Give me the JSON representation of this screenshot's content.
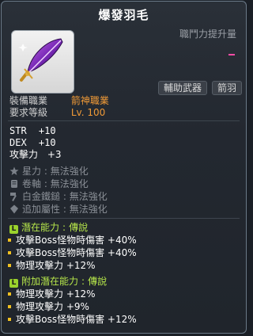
{
  "title": "爆發羽毛",
  "power_label": "職鬥力提升量",
  "tags": [
    "輔助武器",
    "箭羽"
  ],
  "requirements": {
    "job_label": "裝備職業",
    "job_value": "箭神職業",
    "level_label": "要求等級",
    "level_value": "Lv. 100"
  },
  "stats": [
    {
      "name": "STR",
      "value": "+10"
    },
    {
      "name": "DEX",
      "value": "+10"
    },
    {
      "name": "攻擊力",
      "value": "+3"
    }
  ],
  "enhancements": [
    {
      "icon": "star-icon",
      "label": "星力",
      "value": "無法強化"
    },
    {
      "icon": "scroll-icon",
      "label": "卷軸",
      "value": "無法強化"
    },
    {
      "icon": "hammer-icon",
      "label": "白金鐵鎚",
      "value": "無法強化"
    },
    {
      "icon": "gem-icon",
      "label": "追加屬性",
      "value": "無法強化"
    }
  ],
  "potential": {
    "badge": "L",
    "title": "潛在能力",
    "sep": ":",
    "grade": "傳說",
    "lines": [
      "攻擊Boss怪物時傷害 +40%",
      "攻擊Boss怪物時傷害 +40%",
      "物理攻擊力 +12%"
    ]
  },
  "additional_potential": {
    "badge": "L",
    "title": "附加潛在能力",
    "sep": ":",
    "grade": "傳說",
    "lines": [
      "物理攻擊力 +12%",
      "物理攻擊力 +9%",
      "攻擊Boss怪物時傷害 +12%"
    ]
  },
  "colors": {
    "accent_orange": "#f09a37",
    "legendary_green": "#9bd32c",
    "bullet_yellow": "#f0c020",
    "power_pink": "#ff4da6"
  }
}
